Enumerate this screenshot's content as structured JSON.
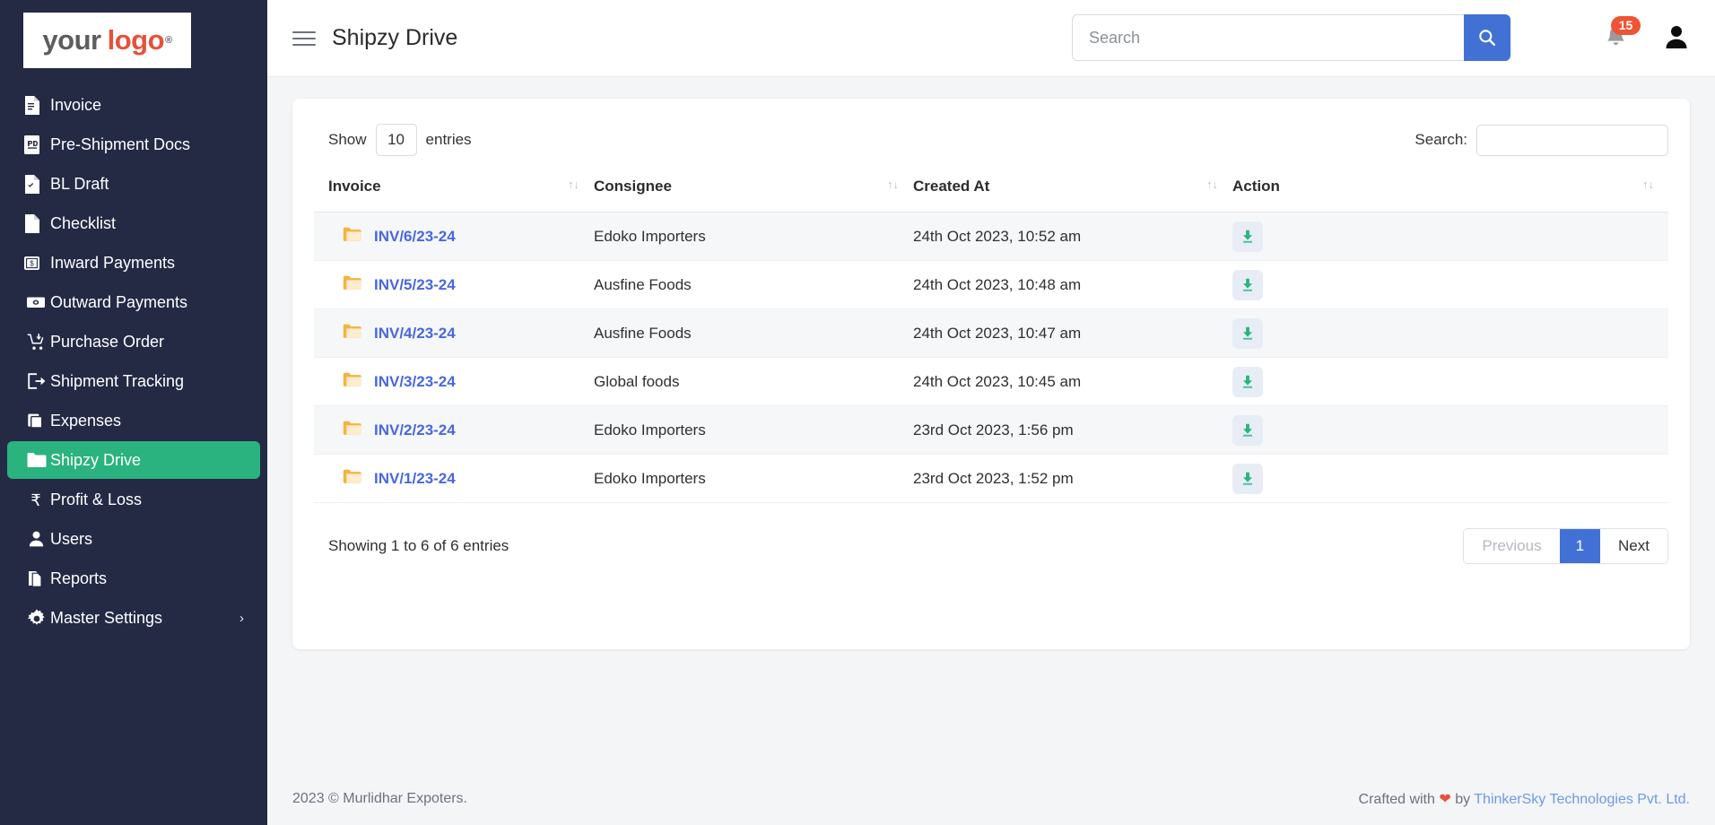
{
  "sidebar": {
    "logo": {
      "part1": "your",
      "part2": "logo",
      "mark": "®"
    },
    "items": [
      {
        "label": "Invoice",
        "icon": "document-icon",
        "active": false
      },
      {
        "label": "Pre-Shipment Docs",
        "icon": "pdf-file-icon",
        "active": false
      },
      {
        "label": "BL Draft",
        "icon": "document-check-icon",
        "active": false
      },
      {
        "label": "Checklist",
        "icon": "blank-page-icon",
        "active": false
      },
      {
        "label": "Inward Payments",
        "icon": "money-in-icon",
        "active": false
      },
      {
        "label": "Outward Payments",
        "icon": "money-out-icon",
        "active": false
      },
      {
        "label": "Purchase Order",
        "icon": "cart-icon",
        "active": false
      },
      {
        "label": "Shipment Tracking",
        "icon": "shipment-tracking-icon",
        "active": false
      },
      {
        "label": "Expenses",
        "icon": "layers-icon",
        "active": false
      },
      {
        "label": "Shipzy Drive",
        "icon": "folder-icon",
        "active": true
      },
      {
        "label": "Profit & Loss",
        "icon": "rupee-icon",
        "active": false
      },
      {
        "label": "Users",
        "icon": "user-icon",
        "active": false
      },
      {
        "label": "Reports",
        "icon": "reports-icon",
        "active": false
      },
      {
        "label": "Master Settings",
        "icon": "gear-icon",
        "active": false,
        "caret": "›"
      }
    ]
  },
  "topbar": {
    "title": "Shipzy Drive",
    "search_placeholder": "Search",
    "search_value": "",
    "notification_count": "15"
  },
  "table_controls": {
    "show_label": "Show",
    "entries_label": "entries",
    "page_length": "10",
    "search_label": "Search:",
    "search_value": ""
  },
  "table": {
    "columns": [
      "Invoice",
      "Consignee",
      "Created At",
      "Action"
    ],
    "rows": [
      {
        "invoice": "INV/6/23-24",
        "consignee": "Edoko Importers",
        "created_at": "24th Oct 2023, 10:52 am",
        "action": "download"
      },
      {
        "invoice": "INV/5/23-24",
        "consignee": "Ausfine Foods",
        "created_at": "24th Oct 2023, 10:48 am",
        "action": "download"
      },
      {
        "invoice": "INV/4/23-24",
        "consignee": "Ausfine Foods",
        "created_at": "24th Oct 2023, 10:47 am",
        "action": "download"
      },
      {
        "invoice": "INV/3/23-24",
        "consignee": "Global foods",
        "created_at": "24th Oct 2023, 10:45 am",
        "action": "download"
      },
      {
        "invoice": "INV/2/23-24",
        "consignee": "Edoko Importers",
        "created_at": "23rd Oct 2023, 1:56 pm",
        "action": "download"
      },
      {
        "invoice": "INV/1/23-24",
        "consignee": "Edoko Importers",
        "created_at": "23rd Oct 2023, 1:52 pm",
        "action": "download"
      }
    ]
  },
  "pagination": {
    "info": "Showing 1 to 6 of 6 entries",
    "previous": "Previous",
    "current_page": "1",
    "next": "Next"
  },
  "footer": {
    "copyright": "2023 © Murlidhar Expoters.",
    "crafted_prefix": "Crafted with",
    "heart": "❤",
    "crafted_by": "by",
    "company": "ThinkerSky Technologies Pvt. Ltd."
  },
  "colors": {
    "sidebar_bg": "#242a44",
    "active_nav": "#2ab37e",
    "primary_blue": "#4271d6",
    "link_blue": "#4a66e0",
    "badge_red": "#ee5435",
    "folder_amber": "#f5b33f",
    "download_green": "#2ab37e"
  }
}
